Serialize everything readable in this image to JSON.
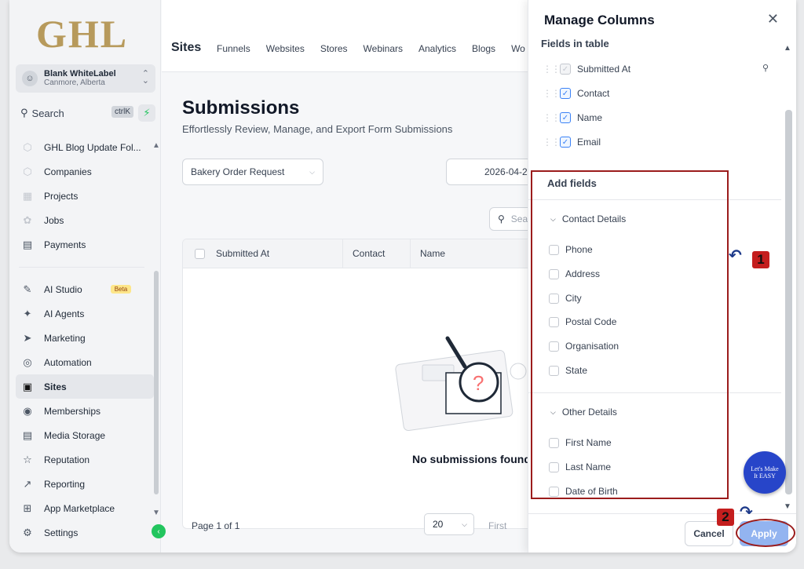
{
  "sidebar": {
    "logo": "GHL",
    "account": {
      "name": "Blank WhiteLabel",
      "location": "Canmore, Alberta"
    },
    "search": {
      "label": "Search",
      "shortcut": "ctrlK"
    },
    "items_top": [
      {
        "label": "GHL Blog Update Fol...",
        "icon": "folder-icon"
      },
      {
        "label": "Companies",
        "icon": "building-icon"
      },
      {
        "label": "Projects",
        "icon": "projects-icon"
      },
      {
        "label": "Jobs",
        "icon": "jobs-icon"
      },
      {
        "label": "Payments",
        "icon": "payments-icon"
      }
    ],
    "items_bottom": [
      {
        "label": "AI Studio",
        "icon": "ai-studio-icon",
        "badge": "Beta"
      },
      {
        "label": "AI Agents",
        "icon": "sparkle-icon"
      },
      {
        "label": "Marketing",
        "icon": "send-icon"
      },
      {
        "label": "Automation",
        "icon": "automation-icon"
      },
      {
        "label": "Sites",
        "icon": "sites-icon",
        "active": true
      },
      {
        "label": "Memberships",
        "icon": "award-icon"
      },
      {
        "label": "Media Storage",
        "icon": "image-icon"
      },
      {
        "label": "Reputation",
        "icon": "star-icon"
      },
      {
        "label": "Reporting",
        "icon": "trend-icon"
      },
      {
        "label": "App Marketplace",
        "icon": "grid-icon"
      },
      {
        "label": "Settings",
        "icon": "gear-icon"
      }
    ]
  },
  "topnav": {
    "title": "Sites",
    "tabs": [
      "Funnels",
      "Websites",
      "Stores",
      "Webinars",
      "Analytics",
      "Blogs",
      "Wo"
    ]
  },
  "main": {
    "title": "Submissions",
    "subtitle": "Effortlessly Review, Manage, and Export Form Submissions",
    "form_select": "Bakery Order Request",
    "date": "2026-04-2",
    "search_placeholder": "Sea",
    "columns": [
      "Submitted At",
      "Contact",
      "Name"
    ],
    "empty_text": "No submissions found",
    "page_info": "Page 1 of 1",
    "per_page": "20",
    "first_label": "First"
  },
  "panel": {
    "title": "Manage Columns",
    "fields_in_table_label": "Fields in table",
    "fields_in_table": [
      {
        "label": "Submitted At",
        "locked": true
      },
      {
        "label": "Contact",
        "locked": false
      },
      {
        "label": "Name",
        "locked": false
      },
      {
        "label": "Email",
        "locked": false
      }
    ],
    "add_fields_label": "Add fields",
    "groups": [
      {
        "name": "Contact Details",
        "options": [
          "Phone",
          "Address",
          "City",
          "Postal Code",
          "Organisation",
          "State"
        ]
      },
      {
        "name": "Other Details",
        "options": [
          "First Name",
          "Last Name",
          "Date of Birth"
        ]
      }
    ],
    "cancel_label": "Cancel",
    "apply_label": "Apply"
  },
  "annotations": {
    "marker_1": "1",
    "marker_2": "2",
    "badge_text": "Let's Make It EASY"
  },
  "colors": {
    "accent": "#3b82f6",
    "apply_bg": "#93b4f0",
    "annotation_red": "#9b1c1c",
    "logo_gold": "#b79a5c"
  }
}
